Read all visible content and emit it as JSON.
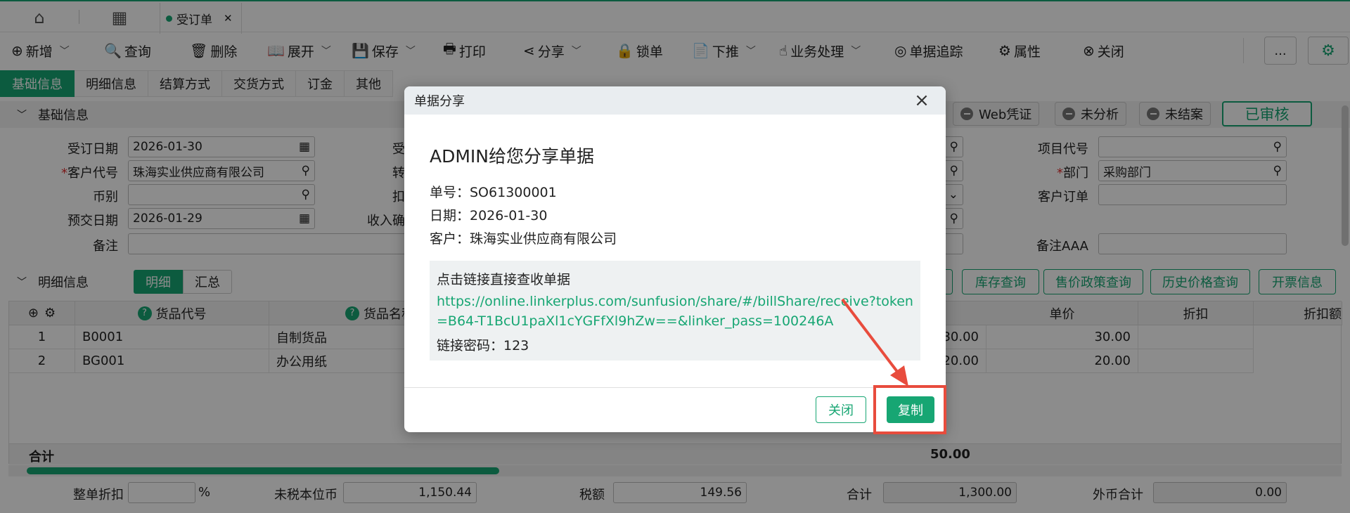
{
  "topbar": {
    "active_tab": "受订单"
  },
  "toolbar": {
    "items": [
      "新增",
      "查询",
      "删除",
      "展开",
      "保存",
      "打印",
      "分享",
      "锁单",
      "下推",
      "业务处理",
      "单据追踪",
      "属性",
      "关闭"
    ],
    "more_label": "..."
  },
  "subtabs": [
    "基础信息",
    "明细信息",
    "结算方式",
    "交货方式",
    "订金",
    "其他"
  ],
  "sections": {
    "basic": "基础信息",
    "detail": "明细信息"
  },
  "form": {
    "order_date_label": "受订日期",
    "order_date": "2026-01-30",
    "customer_label": "客户代号",
    "customer": "珠海实业供应商有限公司",
    "currency_label": "币别",
    "delivery_date_label": "预交日期",
    "delivery_date": "2026-01-29",
    "remark_label": "备注",
    "mid_labels": [
      "受",
      "转",
      "扣",
      "收入确"
    ],
    "project_label": "项目代号",
    "dept_label": "部门",
    "dept": "采购部门",
    "cust_order_label": "客户订单",
    "remark_aaa_label": "备注AAA"
  },
  "status": {
    "web": "Web凭证",
    "analysis": "未分析",
    "close": "未结案",
    "approved": "已审核"
  },
  "detail_toggle": {
    "detail": "明细",
    "summary": "汇总"
  },
  "grid_buttons": [
    "库存查询",
    "售价政策查询",
    "历史价格查询",
    "开票信息"
  ],
  "grid": {
    "headers": [
      "货品代号",
      "货品名称",
      "单价",
      "折扣",
      "折扣额"
    ],
    "rows": [
      {
        "no": "1",
        "code": "B0001",
        "name": "自制货品",
        "amt": "30.00",
        "price": "30.00"
      },
      {
        "no": "2",
        "code": "BG001",
        "name": "办公用纸",
        "amt": "20.00",
        "price": "20.00"
      }
    ],
    "total_label": "合计",
    "total_value": "50.00"
  },
  "footer": {
    "discount_label": "整单折扣",
    "percent": "%",
    "untaxed_label": "未税本位币",
    "untaxed": "1,150.44",
    "tax_label": "税额",
    "tax": "149.56",
    "sum_label": "合计",
    "sum": "1,300.00",
    "foreign_label": "外币合计",
    "foreign": "0.00"
  },
  "dialog": {
    "header": "单据分享",
    "title": "ADMIN给您分享单据",
    "bill_no": "单号：SO61300001",
    "date": "日期：2026-01-30",
    "customer": "客户：珠海实业供应商有限公司",
    "hint": "点击链接直接查收单据",
    "link": "https://online.linkerplus.com/sunfusion/share/#/billShare/receive?token=B64-T1BcU1paXl1cYGFfXl9hZw==&linker_pass=100246A",
    "password": "链接密码：123",
    "close_label": "关闭",
    "copy_label": "复制"
  },
  "colors": {
    "accent": "#17a673",
    "highlight": "#e84c3d"
  }
}
